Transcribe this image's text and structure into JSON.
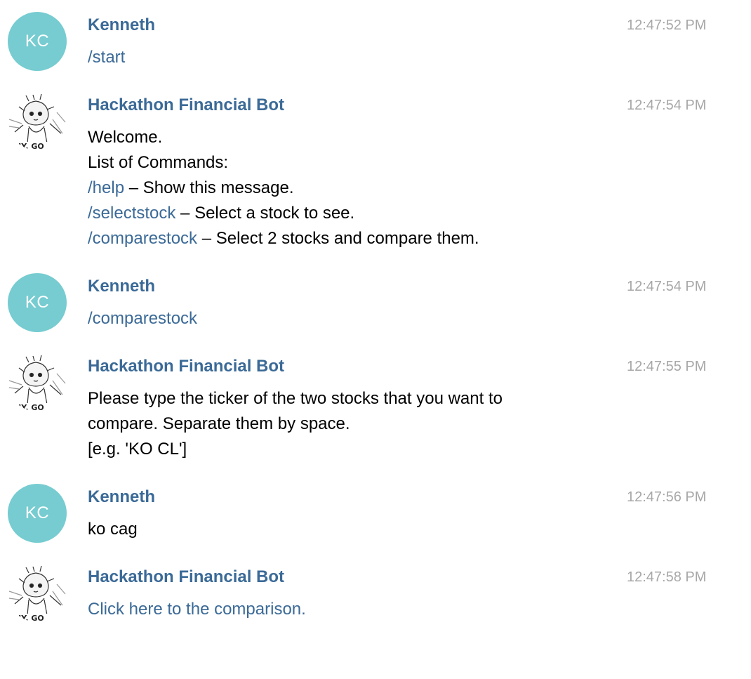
{
  "colors": {
    "sender": "#3b6a97",
    "link": "#3b6a97",
    "time": "#a7a7a7",
    "avatar_kc": "#76ccd0",
    "text": "#000000"
  },
  "messages": [
    {
      "sender": "Kenneth",
      "avatar_initials": "KC",
      "time": "12:47:52 PM",
      "command": "/start"
    },
    {
      "sender": "Hackathon Financial Bot",
      "avatar_icon": "manga-character-avatar-icon",
      "time": "12:47:54 PM",
      "lines": [
        {
          "text": "Welcome."
        },
        {
          "text": "List of Commands:"
        },
        {
          "command": "/help",
          "text": " – Show this message."
        },
        {
          "command": "/selectstock",
          "text": " – Select a stock to see."
        },
        {
          "command": "/comparestock",
          "text": " – Select 2 stocks and compare them."
        }
      ]
    },
    {
      "sender": "Kenneth",
      "avatar_initials": "KC",
      "time": "12:47:54 PM",
      "command": "/comparestock"
    },
    {
      "sender": "Hackathon Financial Bot",
      "avatar_icon": "manga-character-avatar-icon",
      "time": "12:47:55 PM",
      "lines": [
        {
          "text": "Please type the ticker of the two stocks that you want to"
        },
        {
          "text": "compare. Separate them by space."
        },
        {
          "text": "[e.g. 'KO CL']"
        }
      ]
    },
    {
      "sender": "Kenneth",
      "avatar_initials": "KC",
      "time": "12:47:56 PM",
      "text": "ko cag"
    },
    {
      "sender": "Hackathon Financial Bot",
      "avatar_icon": "manga-character-avatar-icon",
      "time": "12:47:58 PM",
      "link": "Click here to the comparison."
    }
  ]
}
